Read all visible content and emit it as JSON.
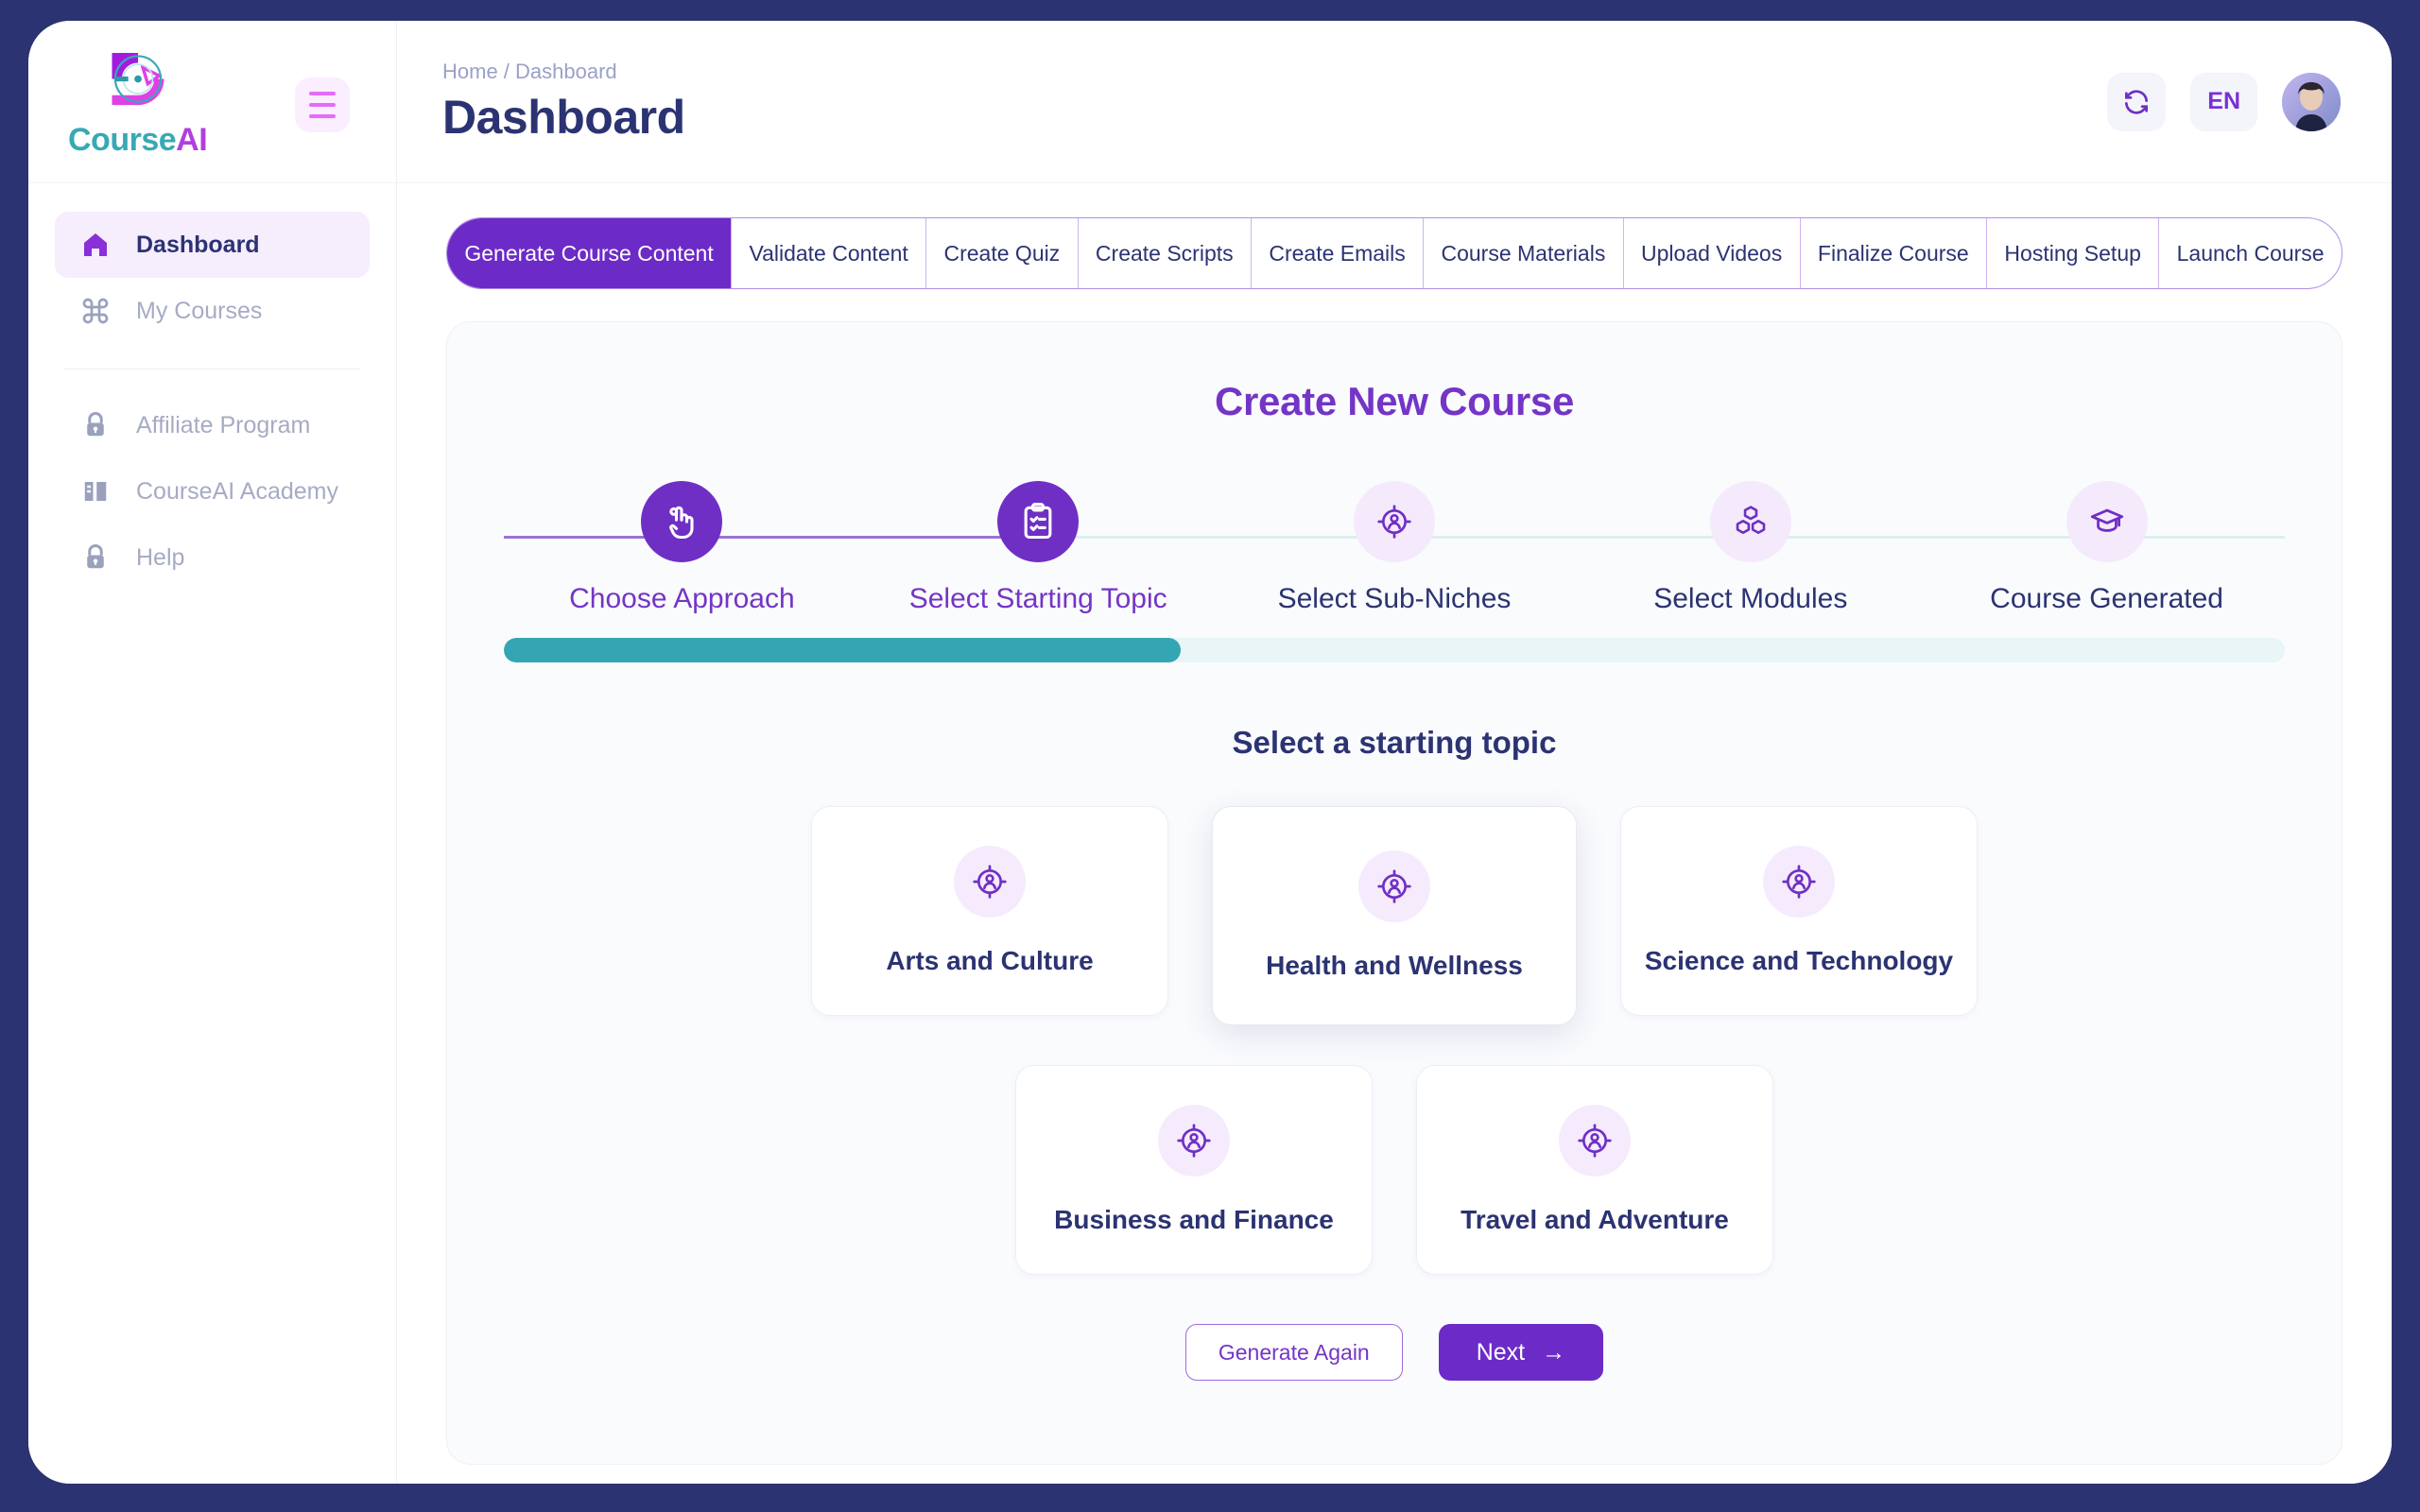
{
  "brand": {
    "name_part1": "Course",
    "name_part2": "AI",
    "logo_icon": "courseai-circular-logo"
  },
  "sidebar": {
    "menu_toggle_icon": "hamburger-menu-icon",
    "items": [
      {
        "label": "Dashboard",
        "icon": "home-icon",
        "active": true
      },
      {
        "label": "My Courses",
        "icon": "grid-command-icon",
        "active": false
      },
      {
        "label": "Affiliate Program",
        "icon": "lock-icon",
        "active": false
      },
      {
        "label": "CourseAI Academy",
        "icon": "book-icon",
        "active": false
      },
      {
        "label": "Help",
        "icon": "lock-icon",
        "active": false
      }
    ]
  },
  "header": {
    "breadcrumb": "Home / Dashboard",
    "title": "Dashboard",
    "refresh_icon": "refresh-icon",
    "language": "EN",
    "avatar_icon": "user-avatar"
  },
  "tabs": [
    {
      "label": "Generate Course Content",
      "active": true
    },
    {
      "label": "Validate Content",
      "active": false
    },
    {
      "label": "Create Quiz",
      "active": false
    },
    {
      "label": "Create Scripts",
      "active": false
    },
    {
      "label": "Create Emails",
      "active": false
    },
    {
      "label": "Course Materials",
      "active": false
    },
    {
      "label": "Upload Videos",
      "active": false
    },
    {
      "label": "Finalize Course",
      "active": false
    },
    {
      "label": "Hosting Setup",
      "active": false
    },
    {
      "label": "Launch Course",
      "active": false
    }
  ],
  "panel": {
    "title": "Create New Course",
    "steps": [
      {
        "label": "Choose Approach",
        "icon": "hand-pointer-icon",
        "state": "done"
      },
      {
        "label": "Select Starting Topic",
        "icon": "clipboard-checklist-icon",
        "state": "current"
      },
      {
        "label": "Select Sub-Niches",
        "icon": "person-target-icon",
        "state": "upcoming"
      },
      {
        "label": "Select Modules",
        "icon": "stacked-cubes-icon",
        "state": "upcoming"
      },
      {
        "label": "Course Generated",
        "icon": "graduation-cap-icon",
        "state": "upcoming"
      }
    ],
    "progress_percent": 38,
    "select_heading": "Select a starting topic",
    "topics": [
      {
        "label": "Arts and Culture",
        "icon": "person-target-icon",
        "highlight": false
      },
      {
        "label": "Health and Wellness",
        "icon": "person-target-icon",
        "highlight": true
      },
      {
        "label": "Science and Technology",
        "icon": "person-target-icon",
        "highlight": false
      },
      {
        "label": "Business and Finance",
        "icon": "person-target-icon",
        "highlight": false
      },
      {
        "label": "Travel and Adventure",
        "icon": "person-target-icon",
        "highlight": false
      }
    ],
    "generate_again_label": "Generate Again",
    "next_label": "Next",
    "next_arrow": "→"
  },
  "colors": {
    "primary_purple": "#6c2bc7",
    "heading_purple": "#7435c6",
    "navy": "#2b3372",
    "teal": "#34a6b3",
    "magenta": "#e56bfa"
  }
}
